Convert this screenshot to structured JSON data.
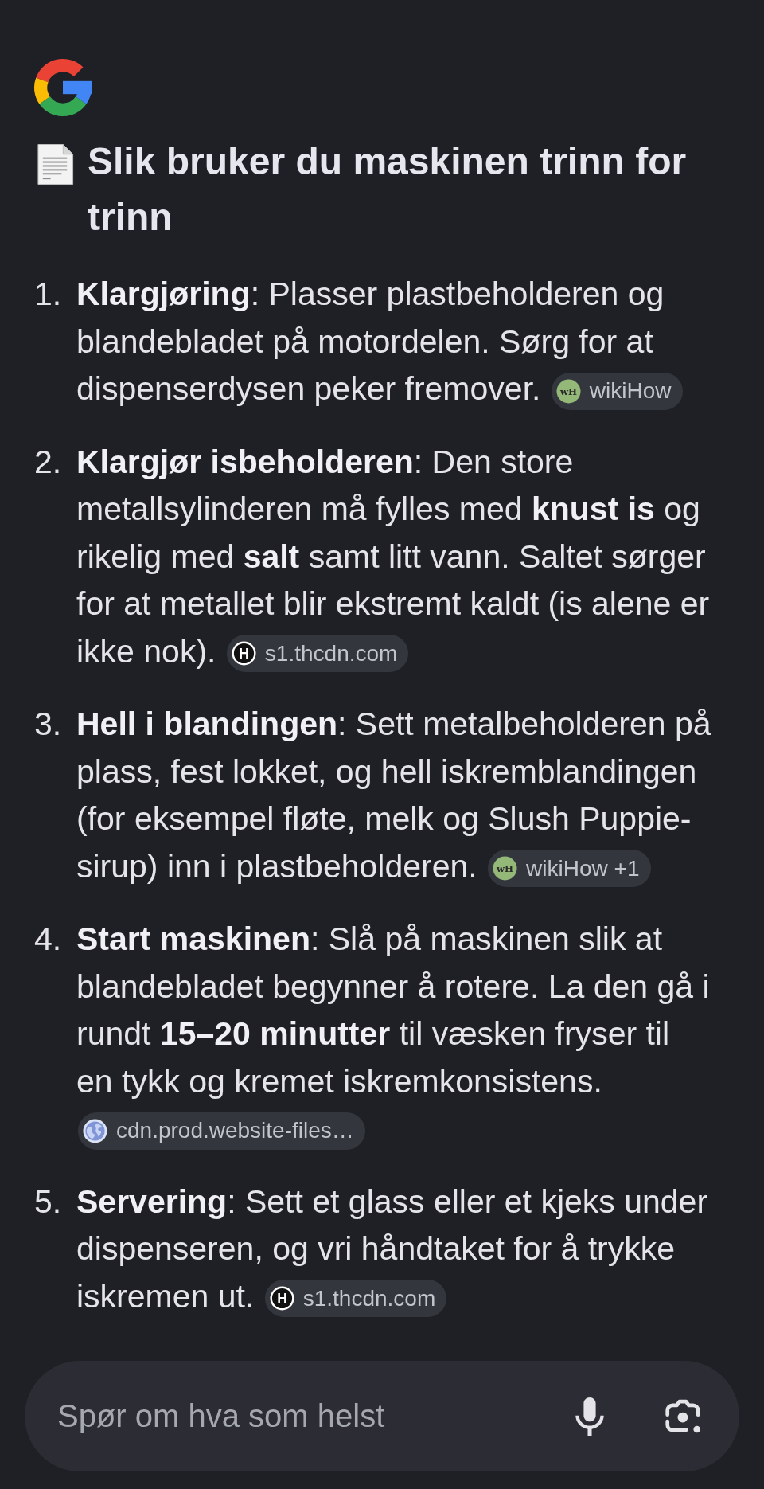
{
  "heading": {
    "text": "Slik bruker du maskinen trinn for trinn"
  },
  "steps": [
    {
      "marker": "1.",
      "text": "**Klargjøring**: Plasser plastbeholderen og blandebladet på motordelen. Sørg for at dispenserdysen peker fremover.",
      "sources": [
        {
          "label": "wikiHow",
          "kind": "wikihow",
          "favicon_text": "wH"
        }
      ]
    },
    {
      "marker": "2.",
      "text": "**Klargjør isbeholderen**: Den store metallsylinderen må fylles med **knust is** og rikelig med **salt** samt litt vann. Saltet sørger for at metallet blir ekstremt kaldt (is alene er ikke nok).",
      "sources": [
        {
          "label": "s1.thcdn.com",
          "kind": "monogram",
          "favicon_text": "H"
        }
      ]
    },
    {
      "marker": "3.",
      "text": "**Hell i blandingen**: Sett metalbeholderen på plass, fest lokket, og hell iskremblandingen (for eksempel fløte, melk og Slush Puppie-sirup) inn i plastbeholderen.",
      "sources": [
        {
          "label": "wikiHow +1",
          "kind": "wikihow",
          "favicon_text": "wH"
        }
      ]
    },
    {
      "marker": "4.",
      "text": "**Start maskinen**: Slå på maskinen slik at blandebladet begynner å rotere. La den gå i rundt **15–20 minutter** til væsken fryser til en tykk og kremet iskremkonsistens.",
      "sources": [
        {
          "label": "cdn.prod.website-files…",
          "kind": "globe"
        }
      ]
    },
    {
      "marker": "5.",
      "text": "**Servering**: Sett et glass eller et kjeks under dispenseren, og vri håndtaket for å trykke iskremen ut.",
      "sources": [
        {
          "label": "s1.thcdn.com",
          "kind": "monogram",
          "favicon_text": "H"
        }
      ]
    }
  ],
  "search": {
    "placeholder": "Spør om hva som helst",
    "buttons": [
      {
        "kind": "mic"
      },
      {
        "kind": "lens"
      }
    ]
  }
}
